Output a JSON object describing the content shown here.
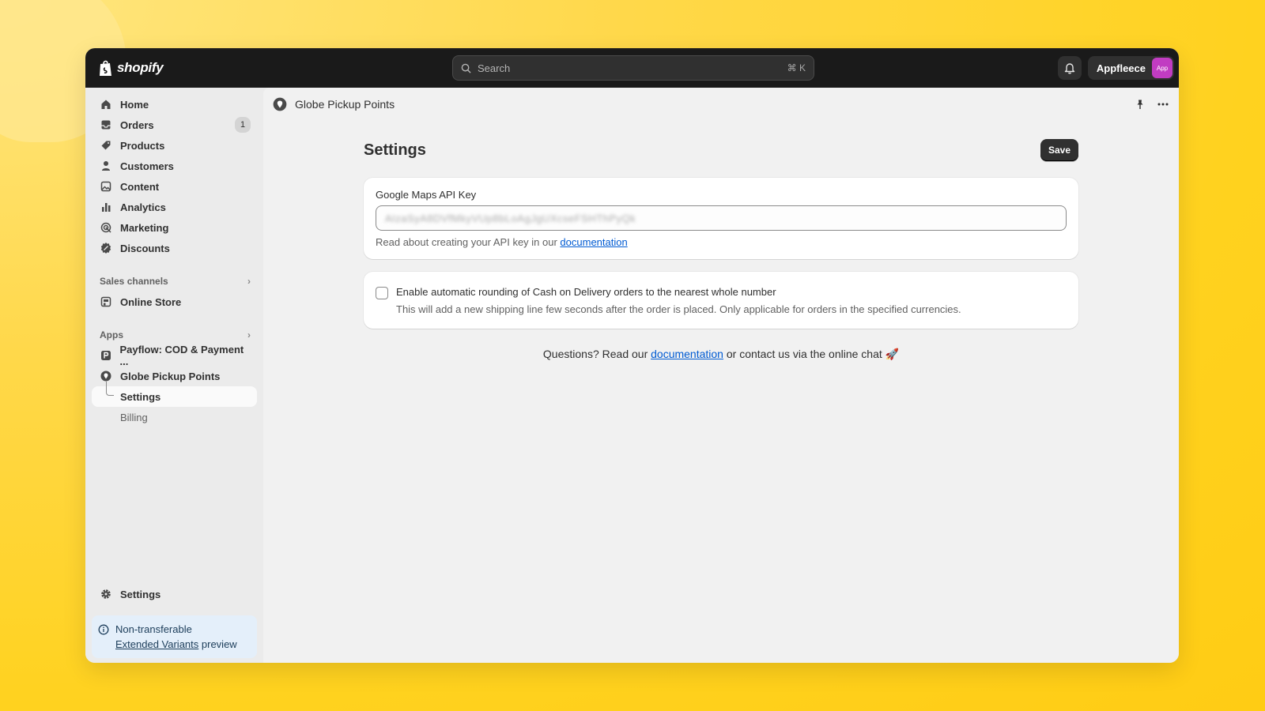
{
  "topbar": {
    "logo_text": "shopify",
    "search_placeholder": "Search",
    "search_shortcut": "⌘ K",
    "account_name": "Appfleece",
    "avatar_text": "App"
  },
  "sidebar": {
    "items": [
      {
        "label": "Home",
        "icon": "home-icon"
      },
      {
        "label": "Orders",
        "icon": "inbox-icon",
        "badge": "1"
      },
      {
        "label": "Products",
        "icon": "tag-icon"
      },
      {
        "label": "Customers",
        "icon": "person-icon"
      },
      {
        "label": "Content",
        "icon": "image-icon"
      },
      {
        "label": "Analytics",
        "icon": "bar-chart-icon"
      },
      {
        "label": "Marketing",
        "icon": "target-icon"
      },
      {
        "label": "Discounts",
        "icon": "discount-icon"
      }
    ],
    "sales_channels_label": "Sales channels",
    "online_store_label": "Online Store",
    "apps_label": "Apps",
    "apps": [
      {
        "label": "Payflow: COD & Payment ..."
      },
      {
        "label": "Globe Pickup Points"
      }
    ],
    "app_sub": [
      {
        "label": "Settings"
      },
      {
        "label": "Billing"
      }
    ],
    "settings_label": "Settings",
    "notice": {
      "line1": "Non-transferable",
      "link": "Extended Variants",
      "line2_suffix": " preview"
    }
  },
  "app_header": {
    "title": "Globe Pickup Points"
  },
  "page": {
    "title": "Settings",
    "save_label": "Save",
    "api_key_label": "Google Maps API Key",
    "api_key_value": "AIzaSyA8DVfMkyVUp8bLoAgJgUXcseFSHThPyQk",
    "help_prefix": "Read about creating your API key in our ",
    "help_link": "documentation",
    "checkbox_label": "Enable automatic rounding of Cash on Delivery orders to the nearest whole number",
    "checkbox_desc": "This will add a new shipping line few seconds after the order is placed. Only applicable for orders in the specified currencies.",
    "footer_prefix": "Questions? Read our ",
    "footer_link": "documentation",
    "footer_suffix": " or contact us via the online chat 🚀"
  },
  "colors": {
    "accent_link": "#005bd3",
    "avatar_bg": "#c13cc2",
    "topbar_bg": "#1a1a1a"
  }
}
